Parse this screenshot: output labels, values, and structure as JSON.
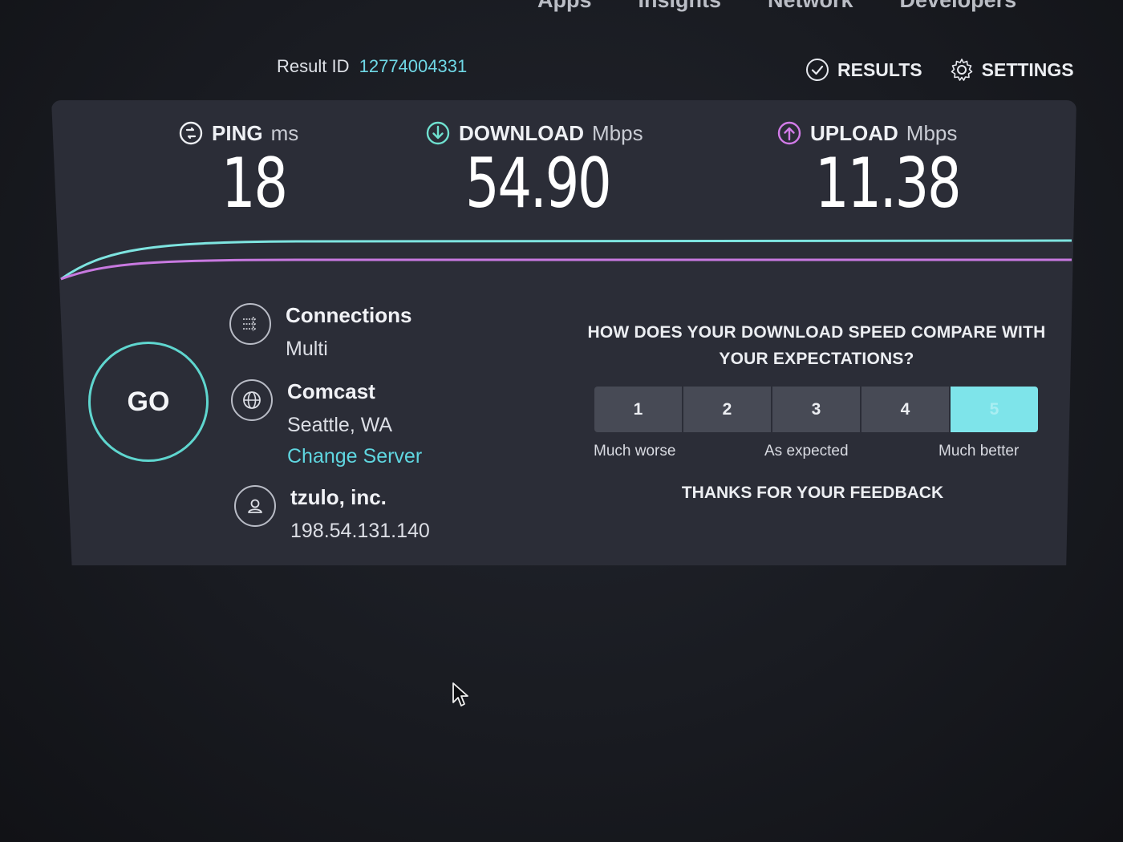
{
  "topnav": {
    "items": [
      "Apps",
      "Insights",
      "Network",
      "Developers"
    ]
  },
  "header": {
    "result_id_label": "Result ID",
    "result_id_value": "12774004331",
    "results_label": "RESULTS",
    "settings_label": "SETTINGS"
  },
  "metrics": {
    "ping": {
      "label": "PING",
      "unit": "ms",
      "value": "18"
    },
    "download": {
      "label": "DOWNLOAD",
      "unit": "Mbps",
      "value": "54.90"
    },
    "upload": {
      "label": "UPLOAD",
      "unit": "Mbps",
      "value": "11.38"
    }
  },
  "go_label": "GO",
  "connections": {
    "label": "Connections",
    "value": "Multi"
  },
  "isp": {
    "name": "Comcast",
    "location": "Seattle, WA",
    "change_label": "Change Server"
  },
  "host": {
    "name": "tzulo, inc.",
    "ip": "198.54.131.140"
  },
  "feedback": {
    "question": "HOW DOES YOUR DOWNLOAD SPEED COMPARE WITH YOUR EXPECTATIONS?",
    "options": [
      "1",
      "2",
      "3",
      "4",
      "5"
    ],
    "selected": "5",
    "label_low": "Much worse",
    "label_mid": "As expected",
    "label_high": "Much better",
    "thanks": "THANKS FOR YOUR FEEDBACK"
  },
  "colors": {
    "accent_teal": "#5fd6cf",
    "download_line": "#7ee4e0",
    "upload_line": "#c879e0",
    "panel": "#2b2d37"
  }
}
